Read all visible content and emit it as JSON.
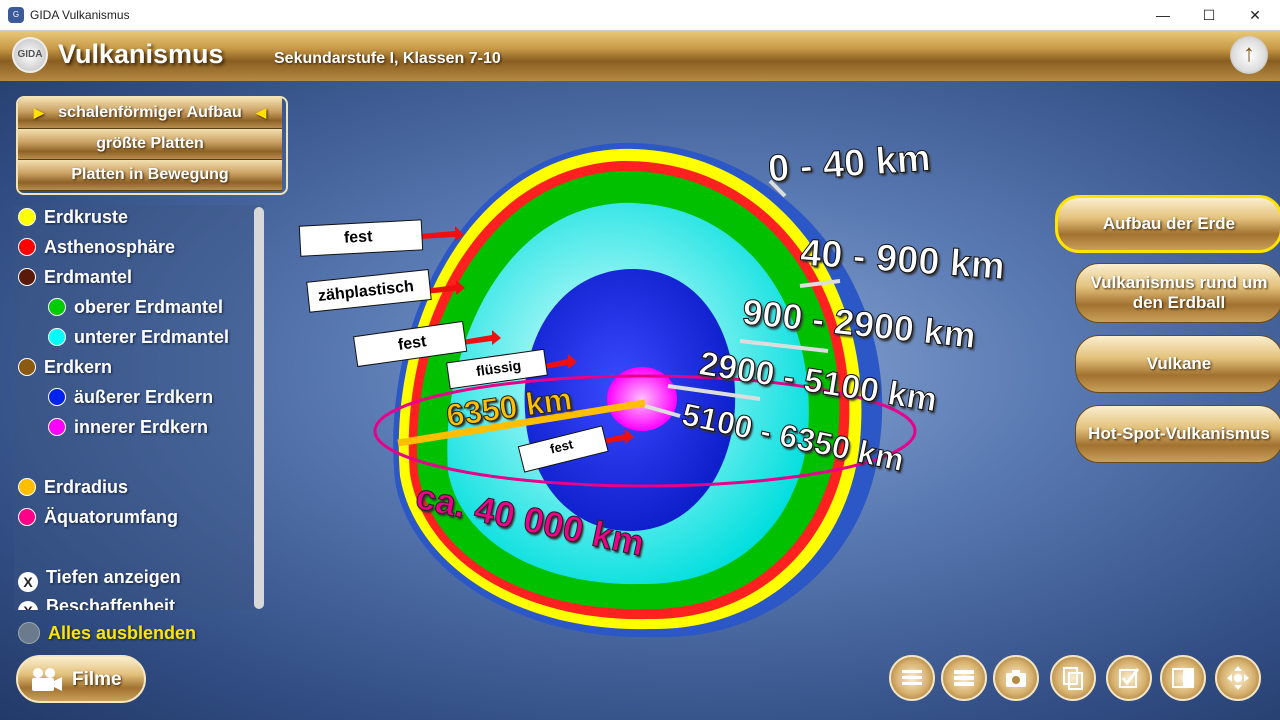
{
  "window": {
    "title": "GIDA Vulkanismus",
    "min": "—",
    "max": "☐",
    "close": "✕"
  },
  "header": {
    "logo": "GIDA",
    "title": "Vulkanismus",
    "subtitle": "Sekundarstufe I, Klassen 7-10",
    "up": "↑"
  },
  "menu": [
    {
      "label": "schalenförmiger Aufbau",
      "selected": true
    },
    {
      "label": "größte Platten",
      "selected": false
    },
    {
      "label": "Platten in Bewegung",
      "selected": false
    }
  ],
  "legend": [
    {
      "label": "Erdkruste",
      "color": "#ffff00"
    },
    {
      "label": "Asthenosphäre",
      "color": "#ff0000"
    },
    {
      "label": "Erdmantel",
      "color": "#5a1a0a"
    },
    {
      "label": "oberer Erdmantel",
      "color": "#00cc00",
      "indent": true
    },
    {
      "label": "unterer Erdmantel",
      "color": "#00ffff",
      "indent": true
    },
    {
      "label": "Erdkern",
      "color": "#8a5a10"
    },
    {
      "label": "äußerer Erdkern",
      "color": "#0022ee",
      "indent": true
    },
    {
      "label": "innerer Erdkern",
      "color": "#ff00ff",
      "indent": true
    },
    {
      "label": "Erdradius",
      "color": "#ffbf00"
    },
    {
      "label": "Äquatorumfang",
      "color": "#ff0088"
    }
  ],
  "toggles": [
    {
      "label": "Tiefen anzeigen"
    },
    {
      "label": "Beschaffenheit"
    }
  ],
  "toggle_mark": "X",
  "hide_all": "Alles ausblenden",
  "sidebar_right": [
    {
      "label": "Aufbau der Erde",
      "active": true
    },
    {
      "label": "Vulkanismus rund um den Erdball",
      "active": false
    },
    {
      "label": "Vulkane",
      "active": false
    },
    {
      "label": "Hot-Spot-Vulkanismus",
      "active": false
    }
  ],
  "earth": {
    "depths": [
      "0 - 40 km",
      "40 - 900 km",
      "900 - 2900 km",
      "2900 - 5100 km",
      "5100 - 6350 km"
    ],
    "states": [
      "fest",
      "zähplastisch",
      "fest",
      "flüssig",
      "fest"
    ],
    "radius": "6350 km",
    "circumference": "ca. 40 000 km"
  },
  "films_label": "Filme",
  "toolbar": [
    "menu-icon",
    "list-icon",
    "camera-icon",
    "copy-icon",
    "checklist-icon",
    "layout-icon",
    "navigate-icon"
  ]
}
